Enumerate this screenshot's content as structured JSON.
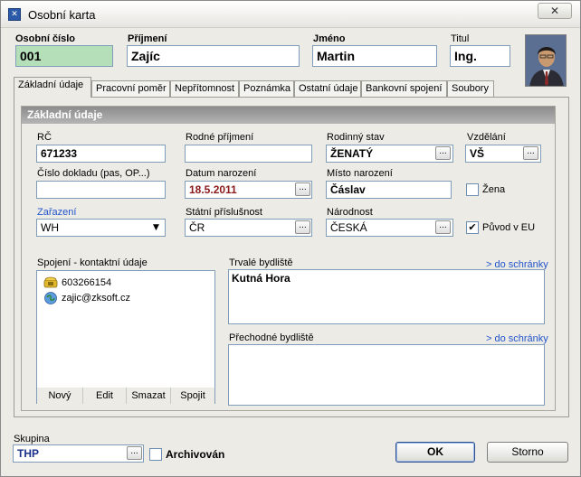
{
  "window": {
    "title": "Osobní karta",
    "close_label": "✕"
  },
  "header": {
    "osobni_cislo": {
      "label": "Osobní číslo",
      "value": "001"
    },
    "prijmeni": {
      "label": "Příjmení",
      "value": "Zajíc"
    },
    "jmeno": {
      "label": "Jméno",
      "value": "Martin"
    },
    "titul": {
      "label": "Titul",
      "value": "Ing."
    }
  },
  "tabs": [
    {
      "label": "Základní údaje",
      "active": true
    },
    {
      "label": "Pracovní poměr"
    },
    {
      "label": "Nepřítomnost"
    },
    {
      "label": "Poznámka"
    },
    {
      "label": "Ostatní údaje"
    },
    {
      "label": "Bankovní spojení"
    },
    {
      "label": "Soubory"
    }
  ],
  "section_title": "Základní údaje",
  "fields": {
    "rc": {
      "label": "RČ",
      "value": "671233"
    },
    "rodne_prijmeni": {
      "label": "Rodné příjmení",
      "value": ""
    },
    "rodinny_stav": {
      "label": "Rodinný stav",
      "value": "ŽENATÝ"
    },
    "vzdelani": {
      "label": "Vzdělání",
      "value": "VŠ"
    },
    "cislo_dokladu": {
      "label": "Číslo dokladu (pas, OP...)",
      "value": ""
    },
    "datum_narozeni": {
      "label": "Datum narození",
      "value": "18.5.2011"
    },
    "misto_narozeni": {
      "label": "Místo narození",
      "value": "Čáslav"
    },
    "zena": {
      "label": "Žena",
      "checked": false
    },
    "zarazeni": {
      "label": "Zařazení",
      "value": "WH"
    },
    "statni_prislusnost": {
      "label": "Státní příslušnost",
      "value": "ČR"
    },
    "narodnost": {
      "label": "Národnost",
      "value": "ČESKÁ"
    },
    "puvod_eu": {
      "label": "Původ v EU",
      "checked": true,
      "mark": "✔"
    }
  },
  "contacts": {
    "label": "Spojení -  kontaktní údaje",
    "items": [
      {
        "icon": "phone-icon",
        "value": "603266154"
      },
      {
        "icon": "email-icon",
        "value": "zajic@zksoft.cz"
      }
    ],
    "buttons": {
      "new": "Nový",
      "edit": "Edit",
      "delete": "Smazat",
      "link": "Spojit"
    }
  },
  "addresses": {
    "permanent": {
      "label": "Trvalé bydliště",
      "link": "> do schránky",
      "value": "Kutná Hora"
    },
    "temporary": {
      "label": "Přechodné bydliště",
      "link": "> do schránky",
      "value": ""
    }
  },
  "footer": {
    "skupina": {
      "label": "Skupina",
      "value": "THP"
    },
    "archivovan": {
      "label": "Archivován",
      "checked": false
    },
    "ok": "OK",
    "storno": "Storno"
  },
  "ellipsis": "..."
}
